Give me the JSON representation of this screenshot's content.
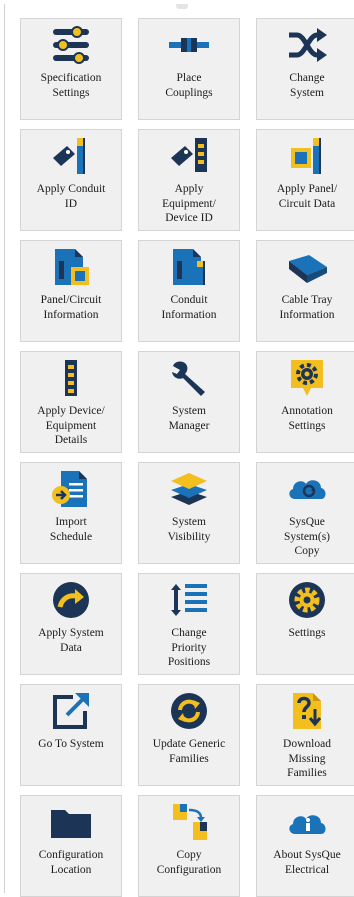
{
  "colors": {
    "navy": "#1c3557",
    "blue": "#1a73b8",
    "yellow": "#f2bf1f",
    "tile_bg": "#f0f0f0"
  },
  "tiles": [
    {
      "label": "Specification\nSettings",
      "icon": "sliders-icon"
    },
    {
      "label": "Place\nCouplings",
      "icon": "coupling-icon"
    },
    {
      "label": "Change\nSystem",
      "icon": "shuffle-icon"
    },
    {
      "label": "Apply Conduit\nID",
      "icon": "conduit-tag-icon"
    },
    {
      "label": "Apply\nEquipment/\nDevice ID",
      "icon": "equipment-tag-icon"
    },
    {
      "label": "Apply Panel/\nCircuit Data",
      "icon": "panel-circuit-icon"
    },
    {
      "label": "Panel/Circuit\nInformation",
      "icon": "panel-info-icon"
    },
    {
      "label": "Conduit\nInformation",
      "icon": "conduit-info-icon"
    },
    {
      "label": "Cable Tray\nInformation",
      "icon": "cable-tray-icon"
    },
    {
      "label": "Apply Device/\nEquipment\nDetails",
      "icon": "device-details-icon"
    },
    {
      "label": "System\nManager",
      "icon": "wrench-icon"
    },
    {
      "label": "Annotation\nSettings",
      "icon": "annotation-gear-icon"
    },
    {
      "label": "Import\nSchedule",
      "icon": "import-document-icon"
    },
    {
      "label": "System\nVisibility",
      "icon": "layers-icon"
    },
    {
      "label": "SysQue\nSystem(s)\nCopy",
      "icon": "cloud-sync-icon"
    },
    {
      "label": "Apply System\nData",
      "icon": "curved-arrow-icon"
    },
    {
      "label": "Change\nPriority\nPositions",
      "icon": "priority-list-icon"
    },
    {
      "label": "Settings",
      "icon": "gear-icon"
    },
    {
      "label": "Go To System",
      "icon": "external-link-icon"
    },
    {
      "label": "Update Generic\nFamilies",
      "icon": "refresh-icon"
    },
    {
      "label": "Download\nMissing\nFamilies",
      "icon": "download-question-icon"
    },
    {
      "label": "Configuration\nLocation",
      "icon": "folder-icon"
    },
    {
      "label": "Copy\nConfiguration",
      "icon": "copy-configuration-icon"
    },
    {
      "label": "About SysQue\nElectrical",
      "icon": "cloud-info-icon"
    }
  ]
}
